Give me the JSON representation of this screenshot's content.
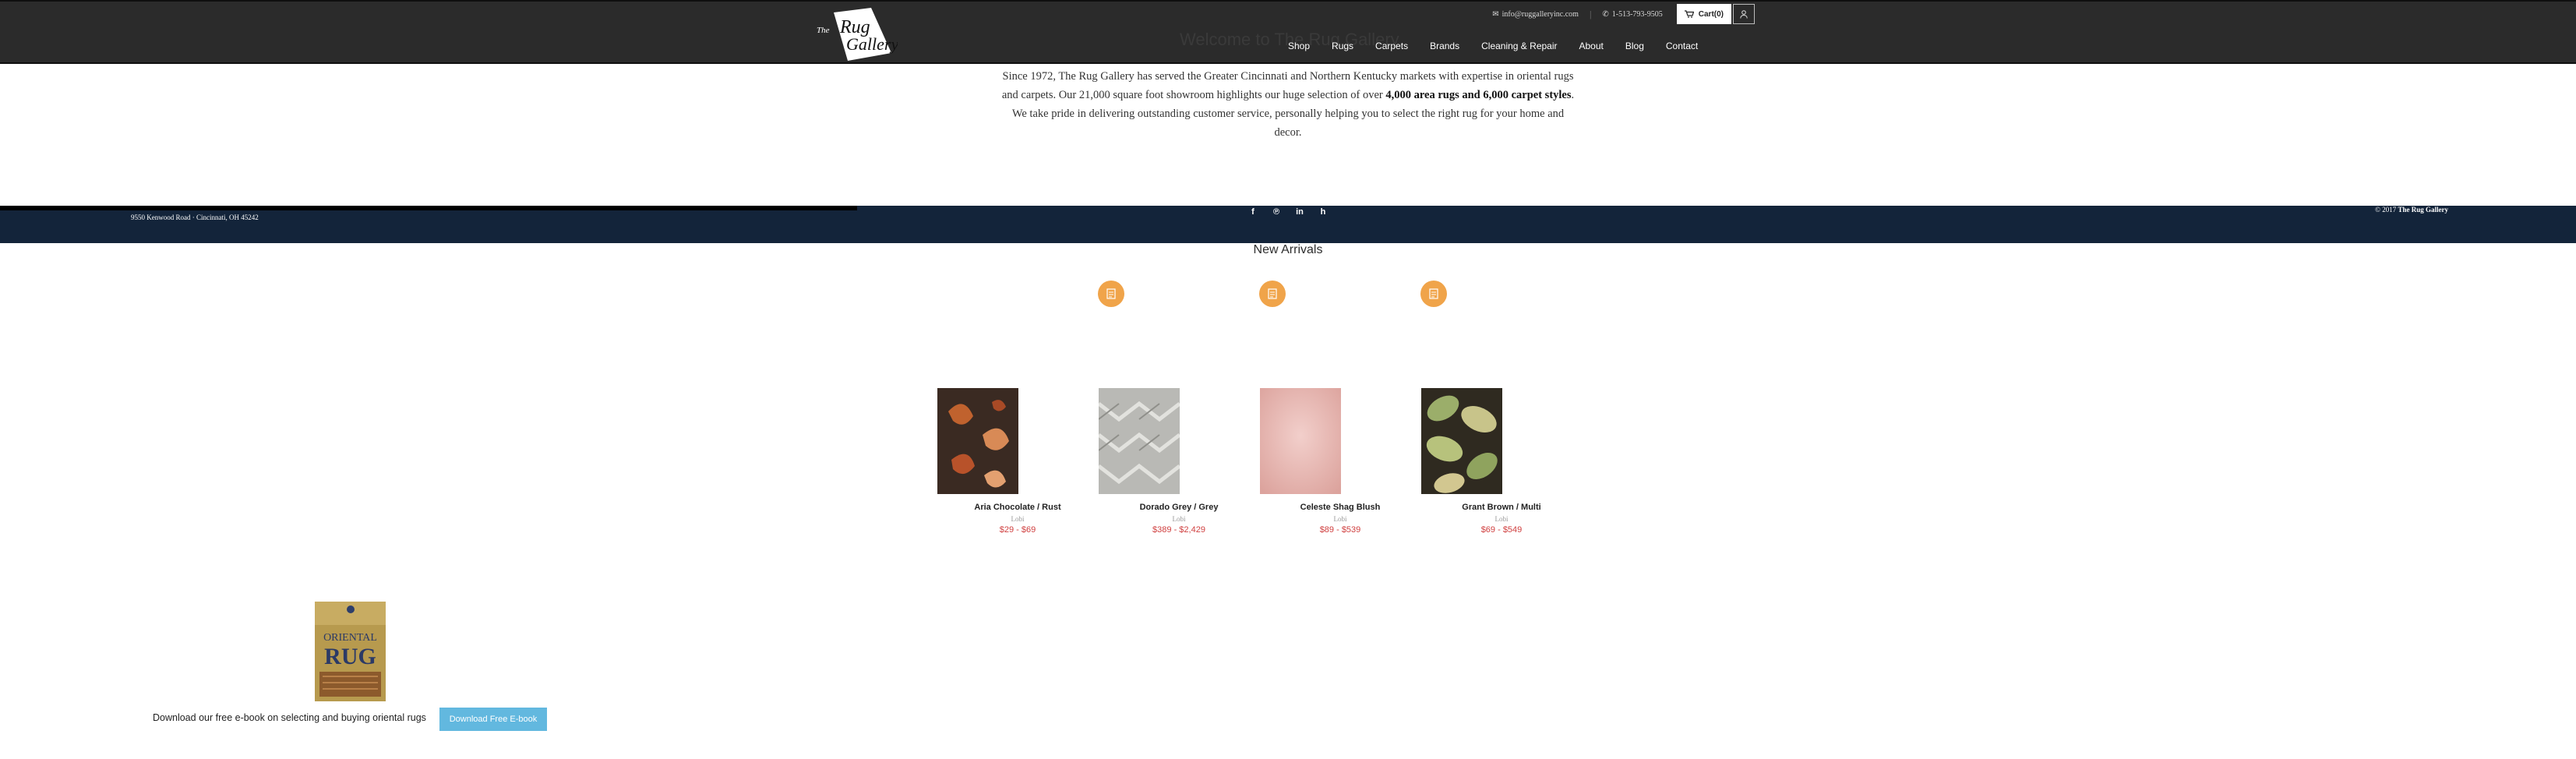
{
  "header": {
    "logo_text": "The Rug Gallery",
    "email": "info@ruggalleryinc.com",
    "phone": "1-513-793-9505",
    "cart_label": "Cart(0)",
    "nav": [
      "Shop",
      "Rugs",
      "Carpets",
      "Brands",
      "Cleaning & Repair",
      "About",
      "Blog",
      "Contact"
    ]
  },
  "intro": {
    "title": "Welcome to The Rug Gallery",
    "text_1": "Since 1972, The Rug Gallery has served the Greater Cincinnati and Northern Kentucky markets with expertise in oriental rugs and carpets. Our 21,000 square foot showroom highlights our huge selection of over ",
    "text_bold": "4,000 area rugs and 6,000 carpet styles",
    "text_2": ". We take pride in delivering outstanding customer service, personally helping you to select the right rug for your home and decor."
  },
  "footer_strip": {
    "address": "9550 Kenwood Road · Cincinnati, OH 45242",
    "copyright_prefix": "© 2017",
    "copyright_name": "The Rug Gallery",
    "social": [
      "facebook-icon",
      "pinterest-icon",
      "linkedin-icon",
      "houzz-icon"
    ]
  },
  "new_arrivals": {
    "title": "New Arrivals",
    "products": [
      {
        "name": "Aria Chocolate / Rust",
        "label": "Lobi",
        "price": "$29 - $69",
        "color": "#3a2a22"
      },
      {
        "name": "Dorado Grey / Grey",
        "label": "Lobi",
        "price": "$389 - $2,429",
        "color": "#b9b9b5"
      },
      {
        "name": "Celeste Shag Blush",
        "label": "Lobi",
        "price": "$89 - $539",
        "color": "#e8bab6"
      },
      {
        "name": "Grant Brown / Multi",
        "label": "Lobi",
        "price": "$69 - $549",
        "color": "#2f2a20"
      }
    ]
  },
  "ebook": {
    "cover_lines": [
      "ORIENTAL",
      "RUG"
    ],
    "text": "Download our free e-book on selecting and buying oriental rugs",
    "button_label": "Download Free E-book"
  },
  "colors": {
    "header_bg": "#2b2b2b",
    "strip_bg": "#13243a",
    "badge": "#f0a44a",
    "price": "#d04040",
    "button": "#62b8df"
  }
}
